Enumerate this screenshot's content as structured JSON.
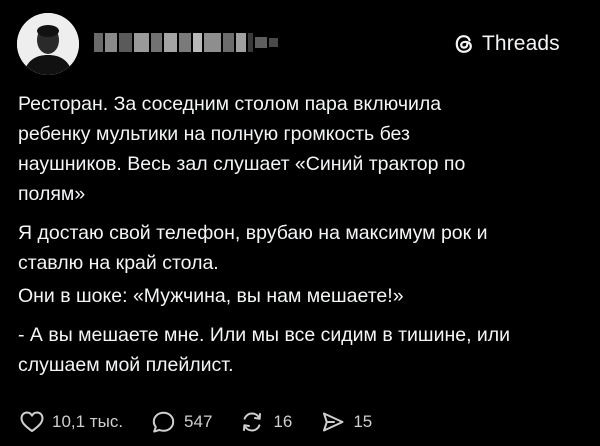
{
  "header": {
    "brand_name": "Threads",
    "brand_icon": "threads-logo-icon"
  },
  "post": {
    "paragraphs": [
      "Ресторан. За соседним столом пара включила\nребенку мультики на полную громкость без\nнаушников. Весь зал слушает «Синий трактор по\nполям»",
      "Я достаю свой телефон, врубаю на максимум рок и\nставлю на край стола.",
      "Они в шоке: «Мужчина, вы нам мешаете!»",
      "- А вы мешаете мне. Или мы все сидим в тишине, или\nслушаем мой плейлист."
    ]
  },
  "actions": {
    "likes": "10,1 тыс.",
    "replies": "547",
    "reposts": "16",
    "shares": "15"
  },
  "colors": {
    "background": "#000000",
    "text": "#f3f5f7",
    "muted": "#cfcfcf"
  }
}
